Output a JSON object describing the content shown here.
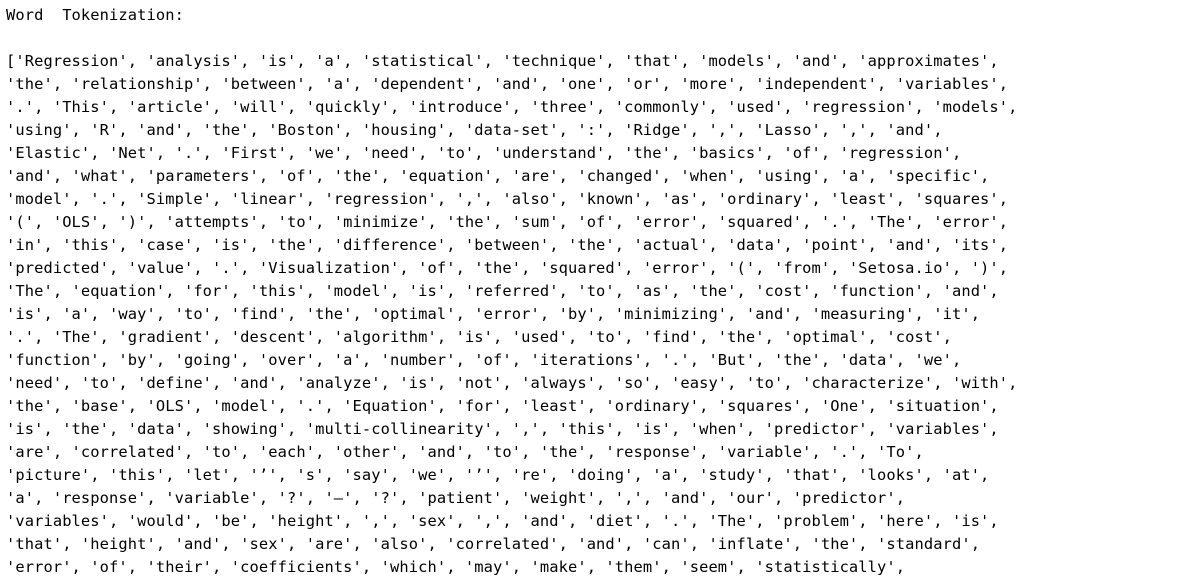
{
  "heading": "Word  Tokenization:",
  "lines": [
    "['Regression', 'analysis', 'is', 'a', 'statistical', 'technique', 'that', 'models', 'and', 'approximates',",
    "'the', 'relationship', 'between', 'a', 'dependent', 'and', 'one', 'or', 'more', 'independent', 'variables',",
    "'.', 'This', 'article', 'will', 'quickly', 'introduce', 'three', 'commonly', 'used', 'regression', 'models',",
    "'using', 'R', 'and', 'the', 'Boston', 'housing', 'data-set', ':', 'Ridge', ',', 'Lasso', ',', 'and',",
    "'Elastic', 'Net', '.', 'First', 'we', 'need', 'to', 'understand', 'the', 'basics', 'of', 'regression',",
    "'and', 'what', 'parameters', 'of', 'the', 'equation', 'are', 'changed', 'when', 'using', 'a', 'specific',",
    "'model', '.', 'Simple', 'linear', 'regression', ',', 'also', 'known', 'as', 'ordinary', 'least', 'squares',",
    "'(', 'OLS', ')', 'attempts', 'to', 'minimize', 'the', 'sum', 'of', 'error', 'squared', '.', 'The', 'error',",
    "'in', 'this', 'case', 'is', 'the', 'difference', 'between', 'the', 'actual', 'data', 'point', 'and', 'its',",
    "'predicted', 'value', '.', 'Visualization', 'of', 'the', 'squared', 'error', '(', 'from', 'Setosa.io', ')',",
    "'The', 'equation', 'for', 'this', 'model', 'is', 'referred', 'to', 'as', 'the', 'cost', 'function', 'and',",
    "'is', 'a', 'way', 'to', 'find', 'the', 'optimal', 'error', 'by', 'minimizing', 'and', 'measuring', 'it',",
    "'.', 'The', 'gradient', 'descent', 'algorithm', 'is', 'used', 'to', 'find', 'the', 'optimal', 'cost',",
    "'function', 'by', 'going', 'over', 'a', 'number', 'of', 'iterations', '.', 'But', 'the', 'data', 'we',",
    "'need', 'to', 'define', 'and', 'analyze', 'is', 'not', 'always', 'so', 'easy', 'to', 'characterize', 'with',",
    "'the', 'base', 'OLS', 'model', '.', 'Equation', 'for', 'least', 'ordinary', 'squares', 'One', 'situation',",
    "'is', 'the', 'data', 'showing', 'multi-collinearity', ',', 'this', 'is', 'when', 'predictor', 'variables',",
    "'are', 'correlated', 'to', 'each', 'other', 'and', 'to', 'the', 'response', 'variable', '.', 'To',",
    "'picture', 'this', 'let', '’', 's', 'say', 'we', '’', 're', 'doing', 'a', 'study', 'that', 'looks', 'at',",
    "'a', 'response', 'variable', '?', '—', '?', 'patient', 'weight', ',', 'and', 'our', 'predictor',",
    "'variables', 'would', 'be', 'height', ',', 'sex', ',', 'and', 'diet', '.', 'The', 'problem', 'here', 'is',",
    "'that', 'height', 'and', 'sex', 'are', 'also', 'correlated', 'and', 'can', 'inflate', 'the', 'standard',",
    "'error', 'of', 'their', 'coefficients', 'which', 'may', 'make', 'them', 'seem', 'statistically',"
  ]
}
